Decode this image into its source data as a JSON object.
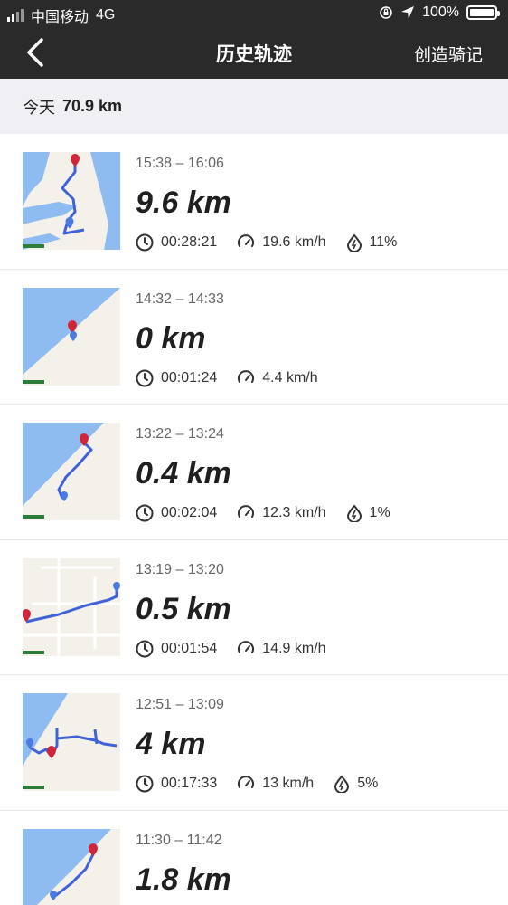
{
  "status_bar": {
    "carrier": "中国移动",
    "network": "4G",
    "battery": "100%"
  },
  "header": {
    "title": "历史轨迹",
    "action": "创造骑记"
  },
  "day": {
    "label": "今天",
    "distance": "70.9 km"
  },
  "rides": [
    {
      "time": "15:38 – 16:06",
      "distance": "9.6 km",
      "duration": "00:28:21",
      "speed": "19.6 km/h",
      "power": "11%"
    },
    {
      "time": "14:32 – 14:33",
      "distance": "0 km",
      "duration": "00:01:24",
      "speed": "4.4 km/h",
      "power": ""
    },
    {
      "time": "13:22 – 13:24",
      "distance": "0.4 km",
      "duration": "00:02:04",
      "speed": "12.3 km/h",
      "power": "1%"
    },
    {
      "time": "13:19 – 13:20",
      "distance": "0.5 km",
      "duration": "00:01:54",
      "speed": "14.9 km/h",
      "power": ""
    },
    {
      "time": "12:51 – 13:09",
      "distance": "4 km",
      "duration": "00:17:33",
      "speed": "13 km/h",
      "power": "5%"
    },
    {
      "time": "11:30 – 11:42",
      "distance": "1.8 km",
      "duration": "",
      "speed": "",
      "power": ""
    }
  ],
  "colors": {
    "header_bg": "#2a2a2a",
    "route": "#3f63d6",
    "pin_end": "#d0253a",
    "pin_start": "#4a7be3",
    "water": "#8fbcf0"
  }
}
